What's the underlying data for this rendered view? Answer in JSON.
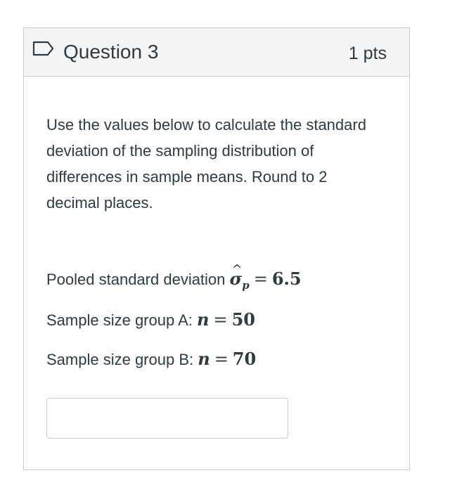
{
  "question": {
    "title": "Question 3",
    "points": "1 pts",
    "prompt": "Use the values below to calculate the standard deviation of the sampling distribution of differences in sample means. Round to 2 decimal places.",
    "values": [
      {
        "label": "Pooled standard deviation",
        "symbol": "σ",
        "subscript": "p",
        "value": "6.5"
      },
      {
        "label": "Sample size group A:",
        "symbol": "n",
        "value": "50"
      },
      {
        "label": "Sample size group B:",
        "symbol": "n",
        "value": "70"
      }
    ],
    "answer": {
      "value": "",
      "placeholder": ""
    }
  },
  "colors": {
    "text": "#2d3b45",
    "border": "#c7cdd1",
    "header_bg": "#f5f5f5"
  },
  "icons": {
    "flag": "flag-icon"
  }
}
